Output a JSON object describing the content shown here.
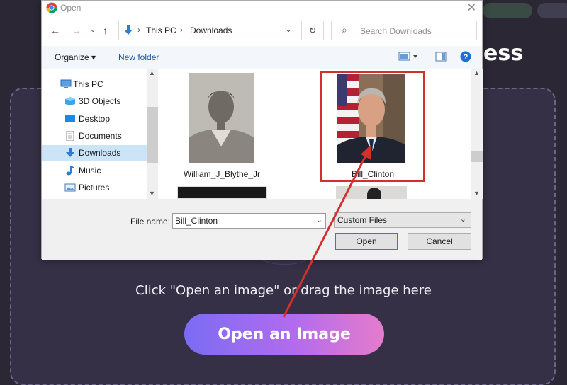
{
  "background": {
    "heading_fragment": "ess",
    "drop_hint": "Click \"Open an image\" or drag the image here",
    "open_image_button": "Open an Image",
    "gradient_colors": [
      "#7a6cf3",
      "#b36bee",
      "#e57ccc"
    ]
  },
  "dialog": {
    "title": "Open",
    "address": [
      "This PC",
      "Downloads"
    ],
    "search_placeholder": "Search Downloads",
    "commands": {
      "organize": "Organize ▾",
      "new_folder": "New folder"
    },
    "tree": [
      {
        "label": "This PC",
        "icon": "computer-icon"
      },
      {
        "label": "3D Objects",
        "icon": "cube-icon"
      },
      {
        "label": "Desktop",
        "icon": "desktop-icon"
      },
      {
        "label": "Documents",
        "icon": "document-icon"
      },
      {
        "label": "Downloads",
        "icon": "download-arrow-icon",
        "selected": true
      },
      {
        "label": "Music",
        "icon": "music-note-icon"
      },
      {
        "label": "Pictures",
        "icon": "pictures-icon"
      }
    ],
    "files": [
      {
        "name": "William_J_Blythe_Jr"
      },
      {
        "name": "Bill_Clinton",
        "selected": true
      }
    ],
    "file_name_label": "File name:",
    "file_name_value": "Bill_Clinton",
    "file_type_value": "Custom Files",
    "open_button": "Open",
    "cancel_button": "Cancel",
    "annotation_color": "#d32f2f"
  }
}
